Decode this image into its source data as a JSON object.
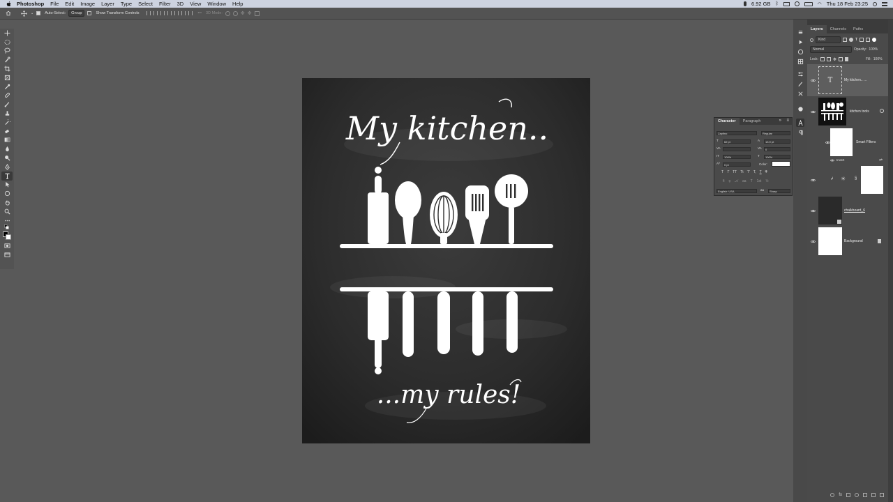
{
  "menubar": {
    "app_name": "Photoshop",
    "menus": [
      "File",
      "Edit",
      "Image",
      "Layer",
      "Type",
      "Select",
      "Filter",
      "3D",
      "View",
      "Window",
      "Help"
    ],
    "memory": "6.92 GB",
    "datetime": "Thu 18 Feb  23:25"
  },
  "options": {
    "auto_select_label": "Auto-Select:",
    "auto_select_value": "Group",
    "transform_label": "Show Transform Controls",
    "mode_label": "3D Mode:"
  },
  "document": {
    "headline": "My kitchen..",
    "tagline": "...my rules!"
  },
  "character_panel": {
    "tabs": [
      "Character",
      "Paragraph"
    ],
    "font_family": "Zapfino",
    "font_style": "Regular",
    "font_size": "62 pt",
    "leading": "13,9 pt",
    "tracking": "0",
    "vertical_scale": "100%",
    "horizontal_scale": "100%",
    "baseline_shift": "0 pt",
    "color_label": "Color:",
    "language": "English: USA",
    "antialias": "Sharp",
    "glyph_buttons": [
      "T",
      "T",
      "TT",
      "Tt",
      "T'",
      "T,",
      "T",
      "T"
    ]
  },
  "layers_panel": {
    "tabs": [
      "Layers",
      "Channels",
      "Paths"
    ],
    "filter_kind": "Kind",
    "blend_mode": "Normal",
    "opacity_label": "Opacity:",
    "opacity": "100%",
    "lock_label": "Lock:",
    "fill_label": "Fill:",
    "fill": "100%",
    "layers": [
      {
        "name": "My kitchen.. ..."
      },
      {
        "name": "kitchen tools"
      },
      {
        "name": "Smart Filters"
      },
      {
        "name": "Invert"
      },
      {
        "name": ""
      },
      {
        "name": "chalkboard_6"
      },
      {
        "name": "Background"
      }
    ]
  },
  "colors": {
    "canvas_bg": "#595959",
    "panel_bg": "#4a4a4a",
    "chalk": "#ffffff",
    "board": "#2b2b2b"
  }
}
